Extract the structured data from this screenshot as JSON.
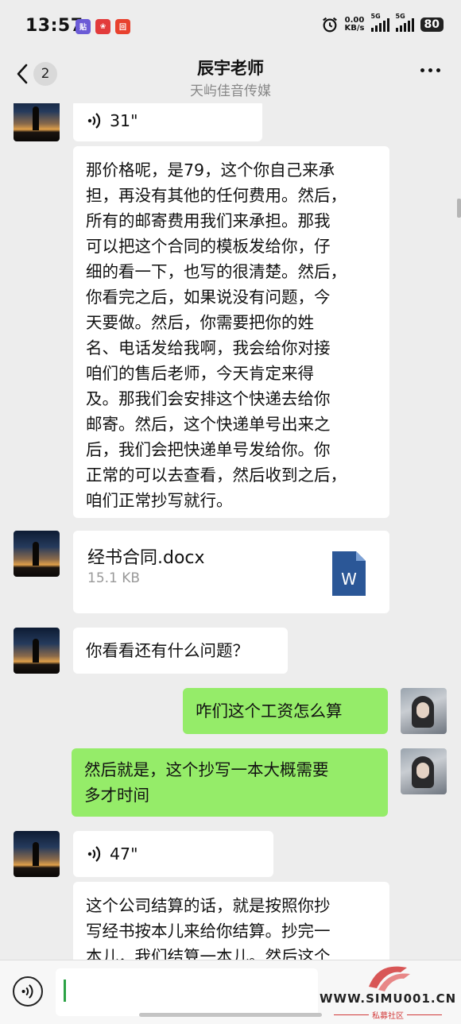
{
  "status_bar": {
    "time": "13:57",
    "net_speed_value": "0.00",
    "net_speed_unit": "KB/s",
    "sim1_label": "5G",
    "sim2_label": "5G",
    "battery": "80",
    "app_icons": [
      "app-badge-1",
      "app-badge-2",
      "app-badge-3"
    ]
  },
  "header": {
    "unread_count": "2",
    "title": "辰宇老师",
    "subtitle": "天屿佳音传媒"
  },
  "messages": [
    {
      "type": "voice",
      "sender": "contact",
      "duration": "31\""
    },
    {
      "type": "text",
      "sender": "contact",
      "lines": [
        "那价格呢，是79，这个你自己来承",
        "担，再没有其他的任何费用。然后，",
        "所有的邮寄费用我们来承担。那我",
        "可以把这个合同的模板发给你，仔",
        "细的看一下，也写的很清楚。然后，",
        "你看完之后，如果说没有问题，今",
        "天要做。然后，你需要把你的姓",
        "名、电话发给我啊，我会给你对接",
        "咱们的售后老师，今天肯定来得",
        "及。那我们会安排这个快递去给你",
        "邮寄。然后，这个快递单号出来之",
        "后，我们会把快递单号发给你。你",
        "正常的可以去查看，然后收到之后，",
        "咱们正常抄写就行。"
      ]
    },
    {
      "type": "file",
      "sender": "contact",
      "file_name": "经书合同.docx",
      "file_size": "15.1 KB",
      "file_icon_letter": "W"
    },
    {
      "type": "text",
      "sender": "contact",
      "lines": [
        "你看看还有什么问题？"
      ]
    },
    {
      "type": "text",
      "sender": "me",
      "lines": [
        "咋们这个工资怎么算"
      ]
    },
    {
      "type": "text",
      "sender": "me",
      "lines": [
        "然后就是，这个抄写一本大概需要",
        "多才时间"
      ]
    },
    {
      "type": "voice",
      "sender": "contact",
      "duration": "47\""
    },
    {
      "type": "text",
      "sender": "contact",
      "lines": [
        "这个公司结算的话，就是按照你抄",
        "写经书按本儿来给你结算。抄完一",
        "本儿，我们结算一本儿。然后这个"
      ]
    }
  ],
  "input_bar": {
    "value": ""
  },
  "watermark": {
    "text": "WWW.SIMU001.CN",
    "sub": "私募社区"
  },
  "colors": {
    "outgoing_bubble": "#95ec69",
    "incoming_bubble": "#ffffff",
    "background": "#ededed",
    "word_blue": "#2b5797"
  }
}
